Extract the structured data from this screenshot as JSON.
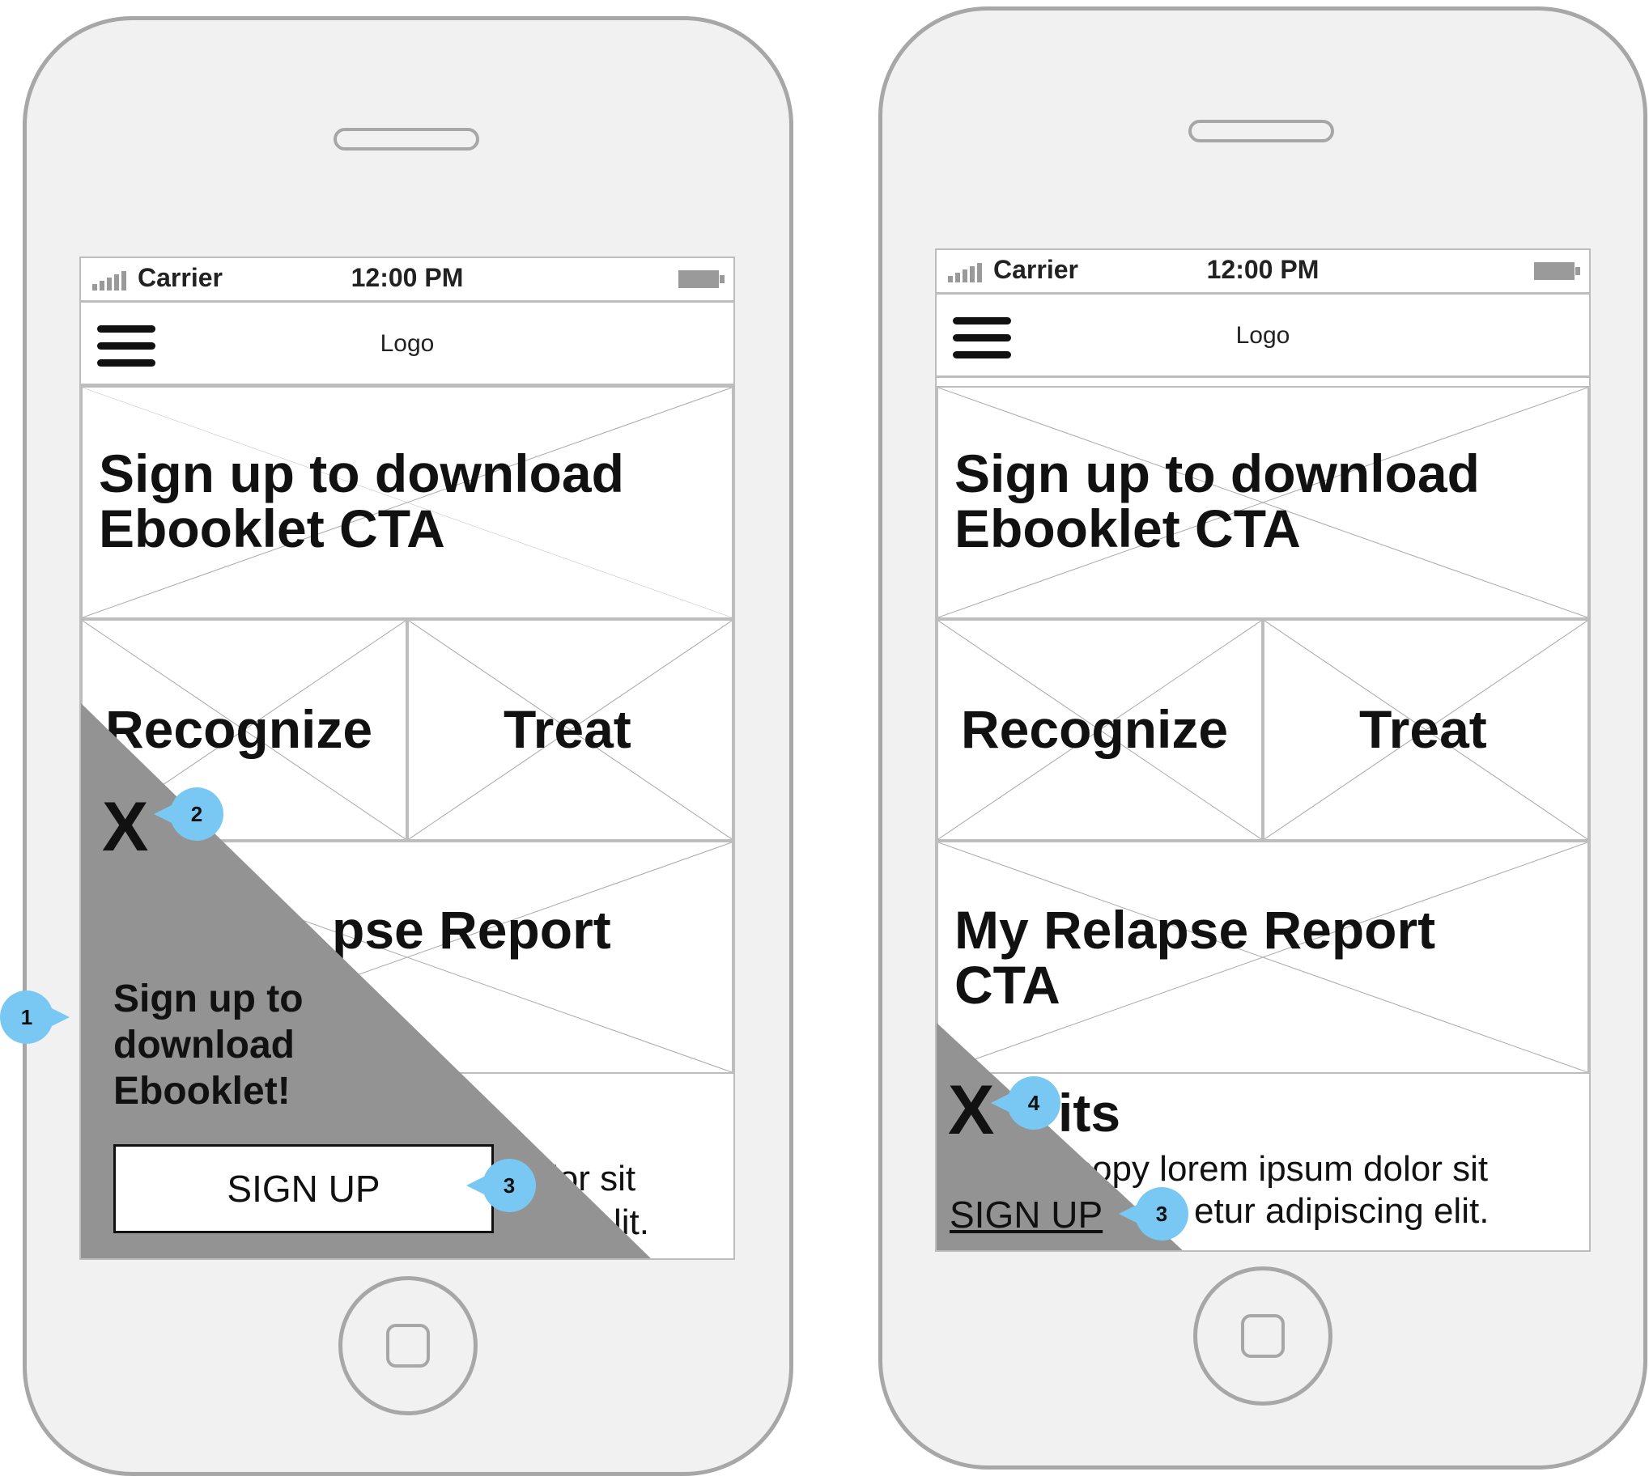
{
  "colors": {
    "device_frame": "#a7a7a7",
    "device_body": "#f1f1f1",
    "overlay": "#939393",
    "callout": "#79c8f3"
  },
  "status_bar": {
    "carrier": "Carrier",
    "time": "12:00 PM"
  },
  "nav": {
    "logo": "Logo",
    "menu_icon": "hamburger-menu-icon"
  },
  "content": {
    "hero_cta": "Sign up to download\nEbooklet CTA",
    "tile_recognize": "Recognize",
    "tile_treat": "Treat",
    "relapse_cta": "My Relapse Report\nCTA",
    "relapse_partial_left": "pse Report",
    "events_heading_partial": "its",
    "body_line1": "copy lorem ipsum dolor sit",
    "body_line2": "etur adipiscing elit.",
    "body_left_line1": "lor sit",
    "body_left_line2": "lit."
  },
  "overlay_expanded": {
    "close": "X",
    "title": "Sign up to\ndownload\nEbooklet!",
    "button": "SIGN UP"
  },
  "overlay_collapsed": {
    "close": "X",
    "link": "SIGN UP"
  },
  "callouts": {
    "c1": "1",
    "c2": "2",
    "c3": "3",
    "c3b": "3",
    "c4": "4"
  }
}
